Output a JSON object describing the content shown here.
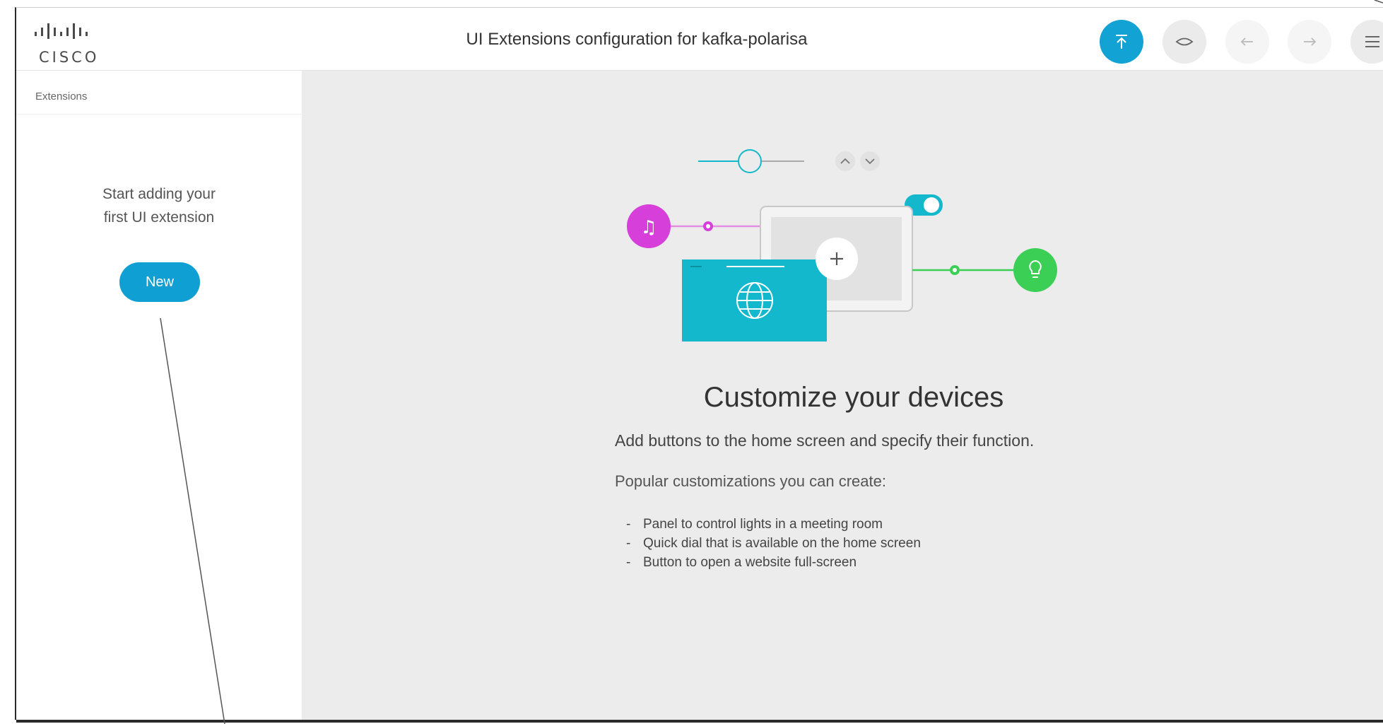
{
  "header": {
    "logo_text": "CISCO",
    "title": "UI Extensions configuration for kafka-polarisa",
    "buttons": [
      {
        "name": "upload",
        "icon": "upload-icon"
      },
      {
        "name": "preview",
        "icon": "eye-icon"
      },
      {
        "name": "undo",
        "icon": "arrow-left-icon"
      },
      {
        "name": "redo",
        "icon": "arrow-right-icon"
      },
      {
        "name": "menu",
        "icon": "hamburger-menu-icon"
      }
    ]
  },
  "sidebar": {
    "heading": "Extensions",
    "empty_line1": "Start adding your",
    "empty_line2": "first UI extension",
    "new_label": "New"
  },
  "main": {
    "heading": "Customize your devices",
    "lead": "Add buttons to the home screen and specify their function.",
    "popular": "Popular customizations you can create:",
    "items": [
      "Panel to control lights in a meeting room",
      "Quick dial that is available on the home screen",
      "Button to open a website full-screen"
    ]
  },
  "colors": {
    "accent": "#12a3d4",
    "teal": "#14b8cc",
    "magenta": "#d63fd9",
    "green": "#3ccf55"
  }
}
